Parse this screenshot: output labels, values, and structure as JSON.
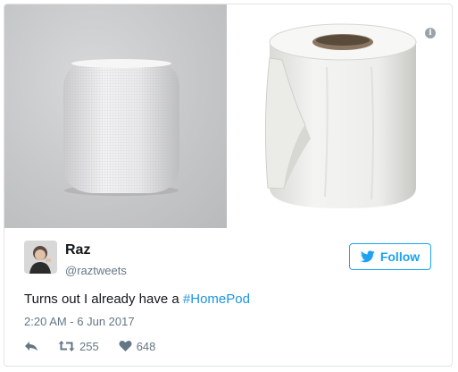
{
  "tweet": {
    "author_name": "Raz",
    "author_handle": "@raztweets",
    "follow_label": "Follow",
    "text_prefix": "Turns out I already have a ",
    "hashtag": "#HomePod",
    "timestamp": "2:20 AM - 6 Jun 2017",
    "retweet_count": "255",
    "like_count": "648"
  },
  "media": {
    "left_image": "homepod-speaker-photo",
    "right_image": "toilet-paper-roll-photo"
  },
  "icons": {
    "info": "info-icon",
    "twitter_bird": "twitter-bird-icon",
    "reply": "reply-icon",
    "retweet": "retweet-icon",
    "like": "heart-icon"
  },
  "colors": {
    "accent": "#1da1f2",
    "hashtag": "#1b95e0",
    "muted": "#657786",
    "text": "#14171a"
  }
}
